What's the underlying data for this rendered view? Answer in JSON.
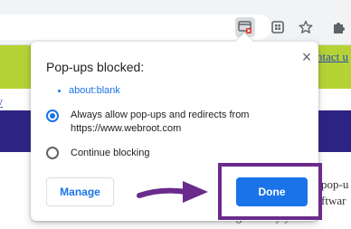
{
  "colors": {
    "accent": "#1a73e8",
    "page_green": "#b5d334",
    "page_purple": "#2d2484",
    "annotation": "#6a2b8c",
    "blocked_indicator_red": "#d93025"
  },
  "toolbar": {
    "icons": [
      "popup-blocked-icon",
      "extension-icon",
      "star-icon",
      "puzzle-icon"
    ]
  },
  "page": {
    "left_link": "y",
    "right_link": "ntact u",
    "text_lines": [
      "pop-u",
      "ftwar",
      "ning the way you v"
    ]
  },
  "popup": {
    "title": "Pop-ups blocked:",
    "blocked_items": [
      "about:blank"
    ],
    "options": [
      {
        "label": "Always allow pop-ups and redirects from https://www.webroot.com",
        "checked": true
      },
      {
        "label": "Continue blocking",
        "checked": false
      }
    ],
    "manage_label": "Manage",
    "done_label": "Done"
  }
}
